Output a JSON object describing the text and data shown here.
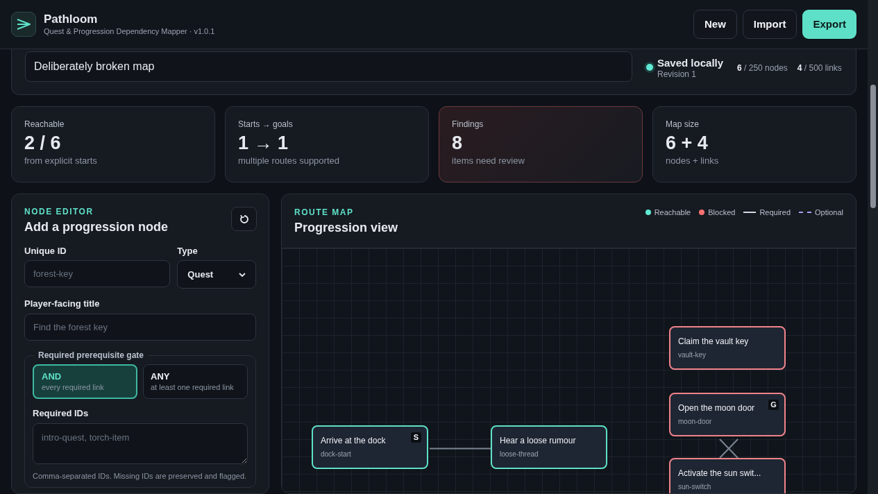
{
  "app": {
    "name": "Pathloom",
    "subtitle": "Quest & Progression Dependency Mapper · v1.0.1"
  },
  "header_buttons": [
    {
      "label": "New",
      "primary": false
    },
    {
      "label": "Import",
      "primary": false
    },
    {
      "label": "Export",
      "primary": true
    }
  ],
  "project": {
    "name_value": "Deliberately broken map",
    "save_status": "Saved locally",
    "revision": "Revision 1",
    "node_count": "6",
    "node_limit": "/ 250 nodes",
    "link_count": "4",
    "link_limit": "/ 500 links"
  },
  "stats": [
    {
      "label": "Reachable",
      "value": "2 / 6",
      "note": "from explicit starts",
      "alert": false
    },
    {
      "label": "Starts → goals",
      "value": "1 → 1",
      "note": "multiple routes supported",
      "alert": false
    },
    {
      "label": "Findings",
      "value": "8",
      "note": "items need review",
      "alert": true
    },
    {
      "label": "Map size",
      "value": "6 + 4",
      "note": "nodes + links",
      "alert": false
    }
  ],
  "node_editor": {
    "eyebrow": "NODE EDITOR",
    "title": "Add a progression node",
    "id_label": "Unique ID",
    "id_placeholder": "forest-key",
    "type_label": "Type",
    "type_value": "Quest",
    "title_label": "Player-facing title",
    "title_placeholder": "Find the forest key",
    "gate_legend": "Required prerequisite gate",
    "gate_options": [
      {
        "label": "AND",
        "hint": "every required link",
        "selected": true
      },
      {
        "label": "ANY",
        "hint": "at least one required link",
        "selected": false
      }
    ],
    "required_label": "Required IDs",
    "required_placeholder": "intro-quest, torch-item",
    "required_help": "Comma-separated IDs. Missing IDs are preserved and flagged."
  },
  "route_map": {
    "eyebrow": "ROUTE MAP",
    "title": "Progression view",
    "legend": [
      {
        "kind": "dot",
        "label": "Reachable",
        "color": "#5eead4"
      },
      {
        "kind": "dot",
        "label": "Blocked",
        "color": "#f87171"
      },
      {
        "kind": "solid",
        "label": "Required"
      },
      {
        "kind": "dashed",
        "label": "Optional"
      }
    ],
    "nodes": [
      {
        "title": "Arrive at the dock",
        "id": "dock-start",
        "reachable": true,
        "badge": "S"
      },
      {
        "title": "Hear a loose rumour",
        "id": "loose-thread",
        "reachable": true
      },
      {
        "title": "Claim the vault key",
        "id": "vault-key",
        "reachable": false
      },
      {
        "title": "Open the moon door",
        "id": "moon-door",
        "reachable": false,
        "badge": "G"
      },
      {
        "title": "Activate the sun swit...",
        "id": "sun-switch",
        "reachable": false
      }
    ]
  }
}
